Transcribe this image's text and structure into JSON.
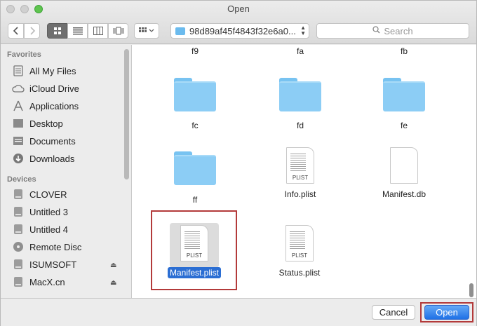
{
  "window": {
    "title": "Open"
  },
  "toolbar": {
    "back_icon": "chevron-left-icon",
    "forward_icon": "chevron-right-icon",
    "path_label": "98d89af45f4843f32e6a0...",
    "search_placeholder": "Search",
    "search_icon": "magnifier-icon"
  },
  "sidebar": {
    "favorites_header": "Favorites",
    "favorites": [
      {
        "label": "All My Files",
        "icon": "all-files-icon"
      },
      {
        "label": "iCloud Drive",
        "icon": "cloud-icon"
      },
      {
        "label": "Applications",
        "icon": "applications-icon"
      },
      {
        "label": "Desktop",
        "icon": "desktop-icon"
      },
      {
        "label": "Documents",
        "icon": "documents-icon"
      },
      {
        "label": "Downloads",
        "icon": "downloads-icon"
      }
    ],
    "devices_header": "Devices",
    "devices": [
      {
        "label": "CLOVER",
        "icon": "drive-icon",
        "eject": false
      },
      {
        "label": "Untitled 3",
        "icon": "drive-icon",
        "eject": false
      },
      {
        "label": "Untitled 4",
        "icon": "drive-icon",
        "eject": false
      },
      {
        "label": "Remote Disc",
        "icon": "disc-icon",
        "eject": false
      },
      {
        "label": "ISUMSOFT",
        "icon": "drive-icon",
        "eject": true
      },
      {
        "label": "MacX.cn",
        "icon": "drive-icon",
        "eject": true
      }
    ]
  },
  "files": {
    "top_row": [
      "f9",
      "fa",
      "fb"
    ],
    "row2": [
      "fc",
      "fd",
      "fe"
    ],
    "row3": [
      {
        "name": "ff",
        "kind": "folder"
      },
      {
        "name": "Info.plist",
        "kind": "plist",
        "tag": "PLIST"
      },
      {
        "name": "Manifest.db",
        "kind": "document"
      }
    ],
    "row4": [
      {
        "name": "Manifest.plist",
        "kind": "plist",
        "tag": "PLIST",
        "selected": true
      },
      {
        "name": "Status.plist",
        "kind": "plist",
        "tag": "PLIST"
      }
    ]
  },
  "footer": {
    "cancel_label": "Cancel",
    "open_label": "Open"
  },
  "colors": {
    "accent": "#2b6ed3",
    "highlight_box": "#b33a3a",
    "folder": "#8ccdf5"
  }
}
